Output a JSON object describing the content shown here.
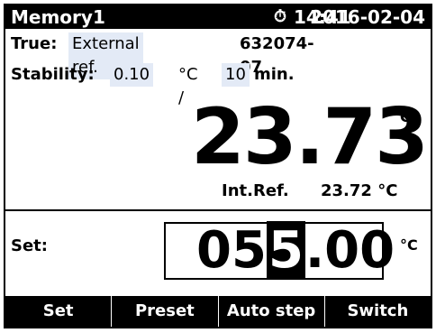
{
  "header": {
    "memory": "Memory1",
    "clock_icon": "clock-icon",
    "clock_glyph": "⏱",
    "time": "14:41",
    "date": "2016-02-04"
  },
  "true_row": {
    "label": "True:",
    "value": "External ref.",
    "serial": "632074-07"
  },
  "stability_row": {
    "label": "Stability:",
    "value": "0.10",
    "unit": "°C /",
    "minutes": "10",
    "minutes_label": "min."
  },
  "reading": {
    "value": "23.73",
    "unit": "°C"
  },
  "internal_ref": {
    "label": "Int.Ref.",
    "value": "23.72 °C"
  },
  "setpoint": {
    "label": "Set:",
    "prefix": "05",
    "cursor_digit": "5",
    "suffix": ".00",
    "unit": "°C"
  },
  "softkeys": [
    "Set",
    "Preset",
    "Auto step",
    "Switch"
  ],
  "colors": {
    "background": "#ffffff",
    "bars": "#000000",
    "highlight": "#e3eaf6"
  }
}
